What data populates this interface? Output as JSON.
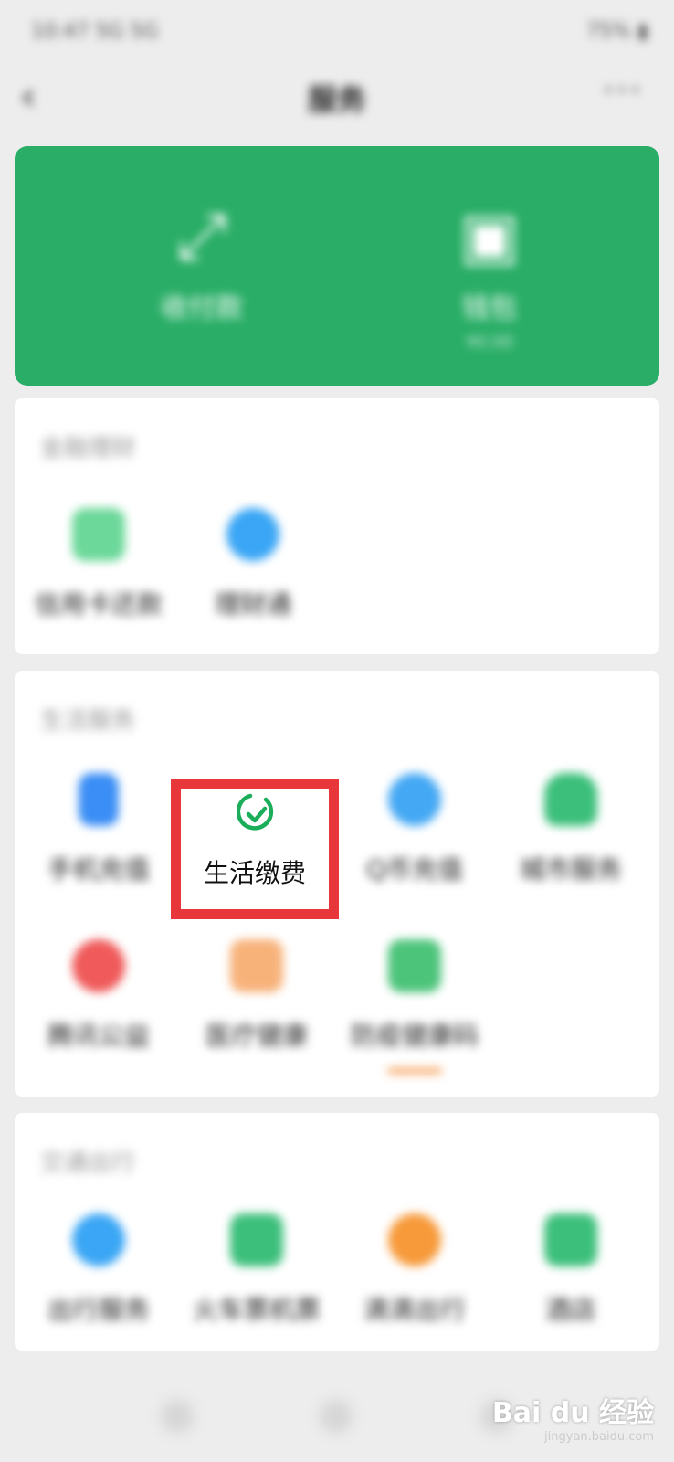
{
  "status_bar": {
    "left": "10:47 5G 5G",
    "right": "75% ▮"
  },
  "nav": {
    "back": "‹",
    "title": "服务",
    "more": "···"
  },
  "top_card": {
    "items": [
      {
        "icon": "scan-pay-icon",
        "label": "收付款",
        "sub": ""
      },
      {
        "icon": "wallet-icon",
        "label": "钱包",
        "sub": "¥0.00"
      }
    ]
  },
  "sections": [
    {
      "title": "金融理财",
      "items": [
        {
          "label": "信用卡还款",
          "icon": "card-repay-icon",
          "color": "#6cd89a"
        },
        {
          "label": "理财通",
          "icon": "wealth-icon",
          "color": "#3aa6f5"
        }
      ]
    },
    {
      "title": "生活服务",
      "items": [
        {
          "label": "手机充值",
          "icon": "phone-topup-icon",
          "color": "#3a8ef5"
        },
        {
          "label": "生活缴费",
          "icon": "life-payment-icon",
          "color": "#1aad5a"
        },
        {
          "label": "Q币充值",
          "icon": "qcoin-icon",
          "color": "#44a8f4"
        },
        {
          "label": "城市服务",
          "icon": "city-service-icon",
          "color": "#3bbf7a"
        },
        {
          "label": "腾讯公益",
          "icon": "charity-icon",
          "color": "#f05a5a"
        },
        {
          "label": "医疗健康",
          "icon": "health-icon",
          "color": "#f7b27a"
        },
        {
          "label": "防疫健康码",
          "icon": "health-code-icon",
          "color": "#4cc47a"
        }
      ]
    },
    {
      "title": "交通出行",
      "items": [
        {
          "label": "出行服务",
          "icon": "travel-icon",
          "color": "#3aa6f5"
        },
        {
          "label": "火车票机票",
          "icon": "train-icon",
          "color": "#3bbf7a"
        },
        {
          "label": "滴滴出行",
          "icon": "didi-icon",
          "color": "#f79a3a"
        },
        {
          "label": "酒店",
          "icon": "hotel-icon",
          "color": "#3bbf7a"
        }
      ]
    }
  ],
  "highlight": {
    "label": "生活缴费"
  },
  "watermark": {
    "brand": "Bai du 经验",
    "url": "jingyan.baidu.com"
  }
}
